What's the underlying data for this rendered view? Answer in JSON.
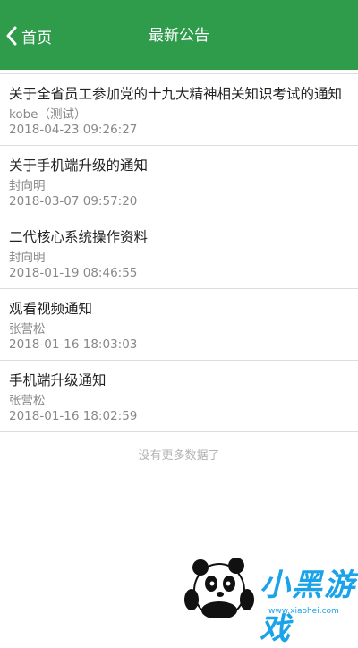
{
  "header": {
    "back_label": "首页",
    "title": "最新公告"
  },
  "announcements": [
    {
      "title": "关于全省员工参加党的十九大精神相关知识考试的通知",
      "author": "kobe（测试）",
      "time": "2018-04-23 09:26:27"
    },
    {
      "title": "关于手机端升级的通知",
      "author": "封向明",
      "time": "2018-03-07 09:57:20"
    },
    {
      "title": "二代核心系统操作资料",
      "author": "封向明",
      "time": "2018-01-19 08:46:55"
    },
    {
      "title": "观看视频通知",
      "author": "张营松",
      "time": "2018-01-16 18:03:03"
    },
    {
      "title": "手机端升级通知",
      "author": "张营松",
      "time": "2018-01-16 18:02:59"
    }
  ],
  "footer": {
    "no_more": "没有更多数据了"
  },
  "watermark": {
    "text": "小黑游戏",
    "url": "www.xiaohei.com"
  },
  "colors": {
    "header_bg": "#2f9c4c",
    "watermark": "#1aa3e8"
  }
}
